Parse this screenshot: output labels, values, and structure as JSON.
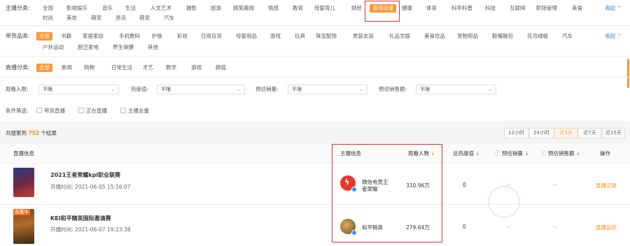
{
  "filters": {
    "anchor_category": {
      "label": "主播分类:",
      "row1": [
        "全部",
        "影视娱乐",
        "音乐",
        "生活",
        "人文艺术",
        "摄影",
        "旅游",
        "搞笑趣闻",
        "情感",
        "教育",
        "母婴育儿",
        "财经",
        "游戏动漫",
        "健康",
        "体育",
        "科学科普",
        "科技",
        "互联网",
        "职场管理",
        "美食"
      ],
      "row2": [
        "时尚",
        "美妆",
        "萌宠",
        "资讯",
        "萌宠",
        "汽车"
      ],
      "active": "游戏动漫",
      "collapse": "收起"
    },
    "goods_category": {
      "label": "带货品类:",
      "row1": [
        "全部",
        "书籍",
        "家居家纺",
        "手机数码",
        "护肤",
        "彩妆",
        "日用百货",
        "母婴用品",
        "游戏",
        "玩具",
        "珠宝配饰",
        "男装女装",
        "礼品文娱",
        "美食饮品",
        "宠物用品",
        "鞋帽箱包",
        "花鸟绿植",
        "汽车"
      ],
      "row2": [
        "户外运动",
        "厨卫家电",
        "养生保健",
        "其他"
      ],
      "active": "全部",
      "collapse": "收起"
    },
    "live_category": {
      "label": "直播分类:",
      "items": [
        "全部",
        "新闻",
        "购物",
        "日常生活",
        "才艺",
        "数学",
        "游戏",
        "颜值"
      ],
      "active": "全部"
    },
    "selects": [
      {
        "label": "观看人数:",
        "value": "不限"
      },
      {
        "label": "热度值:",
        "value": "不限"
      },
      {
        "label": "预估销量:",
        "value": "不限"
      },
      {
        "label": "预估销售额:",
        "value": "不限"
      }
    ],
    "conditions": {
      "label": "条件筛选:",
      "items": [
        "带货直播",
        "正在直播",
        "主播去重"
      ]
    }
  },
  "results": {
    "prefix": "共搜索到",
    "count": "752",
    "suffix": "个结果",
    "time_buttons": [
      "12小时",
      "24小时",
      "近3天",
      "近7天",
      "近15天"
    ],
    "active_time": "近3天"
  },
  "table": {
    "headers": {
      "live_info": "直播信息",
      "anchor_info": "主播信息",
      "viewers": "观看人数",
      "heat": "总热度值",
      "sales": "预估销量",
      "revenue": "预估销售额",
      "action": "操作"
    },
    "rows": [
      {
        "title": "2021王者荣耀kpl职业联赛",
        "start_label": "开播时间:",
        "start_time": "2021-06-05 15:16:07",
        "anchor_line1": "微信电竞王",
        "anchor_line2": "者荣耀",
        "viewers": "310.96万",
        "heat": "0",
        "sales": "--",
        "revenue": "--",
        "action": "直播记录",
        "live_badge": ""
      },
      {
        "title": "KEI和平精英国际邀请赛",
        "start_label": "开播时间:",
        "start_time": "2021-06-07 19:23:38",
        "anchor_line1": "和平精英",
        "anchor_line2": "",
        "viewers": "279.64万",
        "heat": "0",
        "sales": "--",
        "revenue": "--",
        "action": "直播监控",
        "live_badge": "直播中"
      }
    ]
  },
  "colors": {
    "accent": "#ff9533",
    "highlight_box": "#d9342a",
    "link": "#3a7bd5"
  }
}
